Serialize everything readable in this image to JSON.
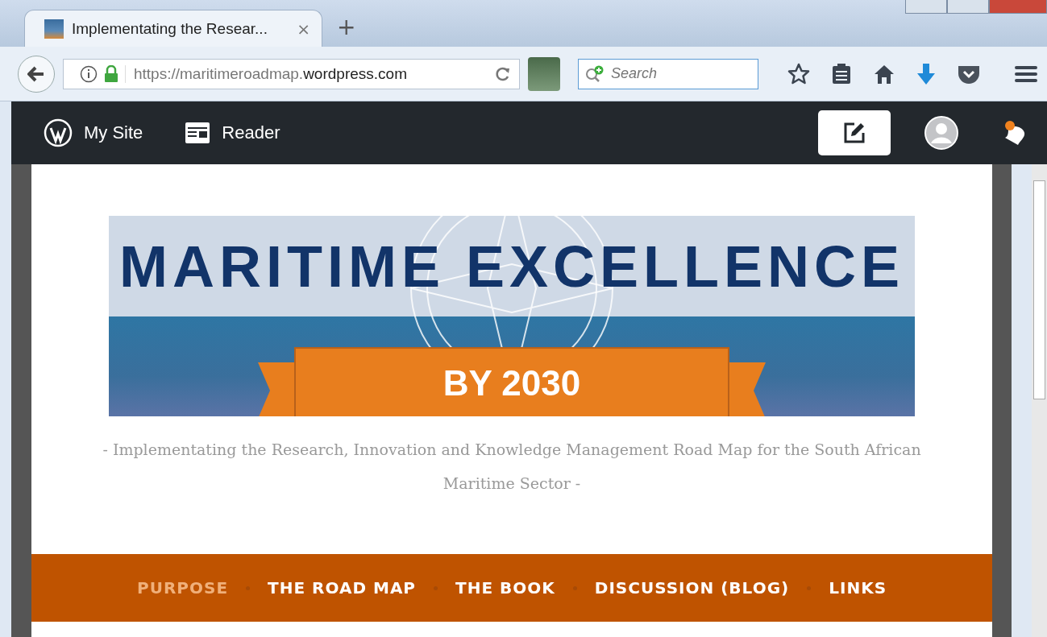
{
  "browser": {
    "tab": {
      "title": "Implementating the Resear...",
      "close": "×"
    },
    "new_tab": "+",
    "address": {
      "prefix": "https://maritimeroadmap.",
      "domain": "wordpress.com"
    },
    "search": {
      "placeholder": "Search"
    }
  },
  "admin_bar": {
    "items": [
      {
        "kind": "wordpress",
        "label": "My Site"
      },
      {
        "kind": "reader",
        "label": "Reader"
      }
    ],
    "notification_unread": true
  },
  "banner": {
    "title": "MARITIME EXCELLENCE",
    "ribbon": "BY 2030"
  },
  "tagline": "- Implementating the Research, Innovation and Knowledge Management Road Map for the South African Maritime Sector -",
  "menu": [
    {
      "label": "PURPOSE",
      "selected": true
    },
    {
      "label": "THE ROAD MAP",
      "selected": false
    },
    {
      "label": "THE BOOK",
      "selected": false
    },
    {
      "label": "DISCUSSION (BLOG)",
      "selected": false
    },
    {
      "label": "LINKS",
      "selected": false
    }
  ]
}
